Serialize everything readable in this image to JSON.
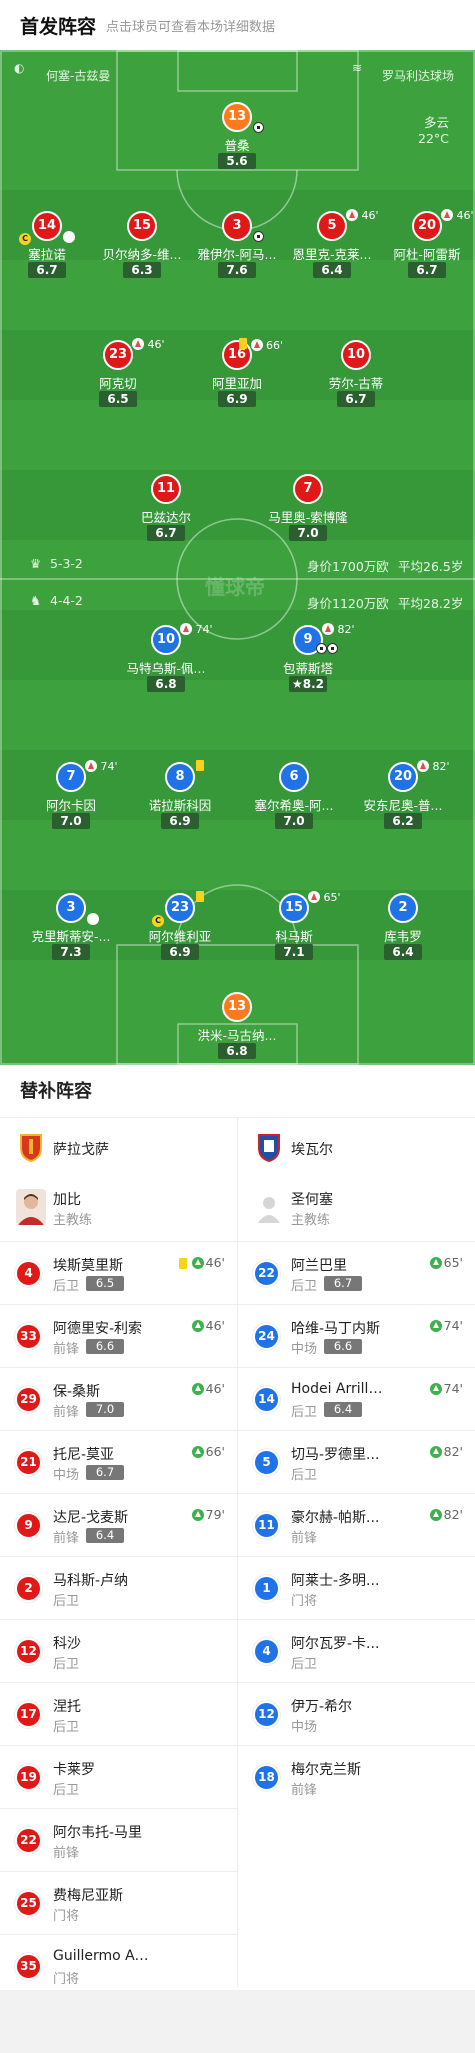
{
  "header": {
    "title": "首发阵容",
    "subtitle": "点击球员可查看本场详细数据"
  },
  "match": {
    "referee": "何塞-古兹曼",
    "stadium": "罗马利达球场",
    "weather": "多云",
    "temp": "22°C",
    "watermark": "懂球帝"
  },
  "formations": {
    "home": {
      "name": "5-3-2",
      "value": "身价1700万欧",
      "age": "平均26.5岁"
    },
    "away": {
      "name": "4-4-2",
      "value": "身价1120万欧",
      "age": "平均28.2岁"
    }
  },
  "home_players": [
    {
      "num": "13",
      "name": "普桑",
      "rating": "5.6"
    },
    {
      "num": "14",
      "name": "塞拉诺",
      "rating": "6.7"
    },
    {
      "num": "15",
      "name": "贝尔纳多-维...",
      "rating": "6.3"
    },
    {
      "num": "3",
      "name": "雅伊尔-阿马...",
      "rating": "7.6"
    },
    {
      "num": "5",
      "name": "恩里克-克莱...",
      "rating": "6.4",
      "ev": "46'"
    },
    {
      "num": "20",
      "name": "阿杜-阿雷斯",
      "rating": "6.7",
      "ev": "46'"
    },
    {
      "num": "23",
      "name": "阿克切",
      "rating": "6.5",
      "ev": "46'"
    },
    {
      "num": "16",
      "name": "阿里亚加",
      "rating": "6.9",
      "ev": "66'"
    },
    {
      "num": "10",
      "name": "劳尔-古蒂",
      "rating": "6.7"
    },
    {
      "num": "11",
      "name": "巴兹达尔",
      "rating": "6.7"
    },
    {
      "num": "7",
      "name": "马里奥-索博隆",
      "rating": "7.0"
    }
  ],
  "away_players": [
    {
      "num": "10",
      "name": "马特乌斯-佩...",
      "rating": "6.8",
      "ev": "74'"
    },
    {
      "num": "9",
      "name": "包蒂斯塔",
      "rating": "8.2",
      "ev": "82'"
    },
    {
      "num": "7",
      "name": "阿尔卡因",
      "rating": "7.0",
      "ev": "74'"
    },
    {
      "num": "8",
      "name": "诺拉斯科因",
      "rating": "6.9"
    },
    {
      "num": "6",
      "name": "塞尔希奥-阿...",
      "rating": "7.0"
    },
    {
      "num": "20",
      "name": "安东尼奥-普...",
      "rating": "6.2",
      "ev": "82'"
    },
    {
      "num": "3",
      "name": "克里斯蒂安-...",
      "rating": "7.3"
    },
    {
      "num": "23",
      "name": "阿尔维利亚",
      "rating": "6.9"
    },
    {
      "num": "15",
      "name": "科马斯",
      "rating": "7.1",
      "ev": "65'"
    },
    {
      "num": "2",
      "name": "库韦罗",
      "rating": "6.4"
    },
    {
      "num": "13",
      "name": "洪米-马古纳...",
      "rating": "6.8"
    }
  ],
  "subs": {
    "title": "替补阵容",
    "home_team": "萨拉戈萨",
    "away_team": "埃瓦尔",
    "home_coach": {
      "name": "加比",
      "role": "主教练"
    },
    "away_coach": {
      "name": "圣何塞",
      "role": "主教练"
    },
    "home": [
      {
        "num": "4",
        "name": "埃斯莫里斯",
        "pos": "后卫",
        "rating": "6.5",
        "min": "46'"
      },
      {
        "num": "33",
        "name": "阿德里安-利索",
        "pos": "前锋",
        "rating": "6.6",
        "min": "46'"
      },
      {
        "num": "29",
        "name": "保-桑斯",
        "pos": "前锋",
        "rating": "7.0",
        "min": "46'"
      },
      {
        "num": "21",
        "name": "托尼-莫亚",
        "pos": "中场",
        "rating": "6.7",
        "min": "66'"
      },
      {
        "num": "9",
        "name": "达尼-戈麦斯",
        "pos": "前锋",
        "rating": "6.4",
        "min": "79'"
      },
      {
        "num": "2",
        "name": "马科斯-卢纳",
        "pos": "后卫"
      },
      {
        "num": "12",
        "name": "科沙",
        "pos": "后卫"
      },
      {
        "num": "17",
        "name": "涅托",
        "pos": "后卫"
      },
      {
        "num": "19",
        "name": "卡莱罗",
        "pos": "后卫"
      },
      {
        "num": "22",
        "name": "阿尔韦托-马里",
        "pos": "前锋"
      },
      {
        "num": "25",
        "name": "费梅尼亚斯",
        "pos": "门将"
      },
      {
        "num": "35",
        "name": "Guillermo Acín",
        "pos": "门将"
      }
    ],
    "away": [
      {
        "num": "22",
        "name": "阿兰巴里",
        "pos": "后卫",
        "rating": "6.7",
        "min": "65'"
      },
      {
        "num": "24",
        "name": "哈维-马丁内斯",
        "pos": "中场",
        "rating": "6.6",
        "min": "74'"
      },
      {
        "num": "14",
        "name": "Hodei Arrillaga",
        "pos": "后卫",
        "rating": "6.4",
        "min": "74'"
      },
      {
        "num": "5",
        "name": "切马-罗德里...",
        "pos": "后卫",
        "min": "82'"
      },
      {
        "num": "11",
        "name": "豪尔赫-帕斯...",
        "pos": "前锋",
        "min": "82'"
      },
      {
        "num": "1",
        "name": "阿莱士-多明...",
        "pos": "门将"
      },
      {
        "num": "4",
        "name": "阿尔瓦罗-卡...",
        "pos": "后卫"
      },
      {
        "num": "12",
        "name": "伊万-希尔",
        "pos": "中场"
      },
      {
        "num": "18",
        "name": "梅尔克兰斯",
        "pos": "前锋"
      }
    ]
  },
  "colors": {
    "home": "#e01818",
    "away": "#1f73e6",
    "pitch": "#3da23e",
    "gk": "#ff7a1e"
  }
}
